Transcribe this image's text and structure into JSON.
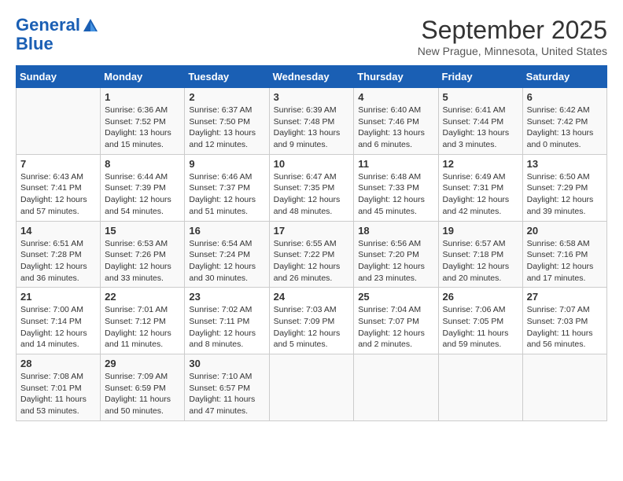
{
  "header": {
    "logo_line1": "General",
    "logo_line2": "Blue",
    "month": "September 2025",
    "location": "New Prague, Minnesota, United States"
  },
  "days_of_week": [
    "Sunday",
    "Monday",
    "Tuesday",
    "Wednesday",
    "Thursday",
    "Friday",
    "Saturday"
  ],
  "weeks": [
    [
      {
        "day": "",
        "content": ""
      },
      {
        "day": "1",
        "content": "Sunrise: 6:36 AM\nSunset: 7:52 PM\nDaylight: 13 hours\nand 15 minutes."
      },
      {
        "day": "2",
        "content": "Sunrise: 6:37 AM\nSunset: 7:50 PM\nDaylight: 13 hours\nand 12 minutes."
      },
      {
        "day": "3",
        "content": "Sunrise: 6:39 AM\nSunset: 7:48 PM\nDaylight: 13 hours\nand 9 minutes."
      },
      {
        "day": "4",
        "content": "Sunrise: 6:40 AM\nSunset: 7:46 PM\nDaylight: 13 hours\nand 6 minutes."
      },
      {
        "day": "5",
        "content": "Sunrise: 6:41 AM\nSunset: 7:44 PM\nDaylight: 13 hours\nand 3 minutes."
      },
      {
        "day": "6",
        "content": "Sunrise: 6:42 AM\nSunset: 7:42 PM\nDaylight: 13 hours\nand 0 minutes."
      }
    ],
    [
      {
        "day": "7",
        "content": "Sunrise: 6:43 AM\nSunset: 7:41 PM\nDaylight: 12 hours\nand 57 minutes."
      },
      {
        "day": "8",
        "content": "Sunrise: 6:44 AM\nSunset: 7:39 PM\nDaylight: 12 hours\nand 54 minutes."
      },
      {
        "day": "9",
        "content": "Sunrise: 6:46 AM\nSunset: 7:37 PM\nDaylight: 12 hours\nand 51 minutes."
      },
      {
        "day": "10",
        "content": "Sunrise: 6:47 AM\nSunset: 7:35 PM\nDaylight: 12 hours\nand 48 minutes."
      },
      {
        "day": "11",
        "content": "Sunrise: 6:48 AM\nSunset: 7:33 PM\nDaylight: 12 hours\nand 45 minutes."
      },
      {
        "day": "12",
        "content": "Sunrise: 6:49 AM\nSunset: 7:31 PM\nDaylight: 12 hours\nand 42 minutes."
      },
      {
        "day": "13",
        "content": "Sunrise: 6:50 AM\nSunset: 7:29 PM\nDaylight: 12 hours\nand 39 minutes."
      }
    ],
    [
      {
        "day": "14",
        "content": "Sunrise: 6:51 AM\nSunset: 7:28 PM\nDaylight: 12 hours\nand 36 minutes."
      },
      {
        "day": "15",
        "content": "Sunrise: 6:53 AM\nSunset: 7:26 PM\nDaylight: 12 hours\nand 33 minutes."
      },
      {
        "day": "16",
        "content": "Sunrise: 6:54 AM\nSunset: 7:24 PM\nDaylight: 12 hours\nand 30 minutes."
      },
      {
        "day": "17",
        "content": "Sunrise: 6:55 AM\nSunset: 7:22 PM\nDaylight: 12 hours\nand 26 minutes."
      },
      {
        "day": "18",
        "content": "Sunrise: 6:56 AM\nSunset: 7:20 PM\nDaylight: 12 hours\nand 23 minutes."
      },
      {
        "day": "19",
        "content": "Sunrise: 6:57 AM\nSunset: 7:18 PM\nDaylight: 12 hours\nand 20 minutes."
      },
      {
        "day": "20",
        "content": "Sunrise: 6:58 AM\nSunset: 7:16 PM\nDaylight: 12 hours\nand 17 minutes."
      }
    ],
    [
      {
        "day": "21",
        "content": "Sunrise: 7:00 AM\nSunset: 7:14 PM\nDaylight: 12 hours\nand 14 minutes."
      },
      {
        "day": "22",
        "content": "Sunrise: 7:01 AM\nSunset: 7:12 PM\nDaylight: 12 hours\nand 11 minutes."
      },
      {
        "day": "23",
        "content": "Sunrise: 7:02 AM\nSunset: 7:11 PM\nDaylight: 12 hours\nand 8 minutes."
      },
      {
        "day": "24",
        "content": "Sunrise: 7:03 AM\nSunset: 7:09 PM\nDaylight: 12 hours\nand 5 minutes."
      },
      {
        "day": "25",
        "content": "Sunrise: 7:04 AM\nSunset: 7:07 PM\nDaylight: 12 hours\nand 2 minutes."
      },
      {
        "day": "26",
        "content": "Sunrise: 7:06 AM\nSunset: 7:05 PM\nDaylight: 11 hours\nand 59 minutes."
      },
      {
        "day": "27",
        "content": "Sunrise: 7:07 AM\nSunset: 7:03 PM\nDaylight: 11 hours\nand 56 minutes."
      }
    ],
    [
      {
        "day": "28",
        "content": "Sunrise: 7:08 AM\nSunset: 7:01 PM\nDaylight: 11 hours\nand 53 minutes."
      },
      {
        "day": "29",
        "content": "Sunrise: 7:09 AM\nSunset: 6:59 PM\nDaylight: 11 hours\nand 50 minutes."
      },
      {
        "day": "30",
        "content": "Sunrise: 7:10 AM\nSunset: 6:57 PM\nDaylight: 11 hours\nand 47 minutes."
      },
      {
        "day": "",
        "content": ""
      },
      {
        "day": "",
        "content": ""
      },
      {
        "day": "",
        "content": ""
      },
      {
        "day": "",
        "content": ""
      }
    ]
  ]
}
